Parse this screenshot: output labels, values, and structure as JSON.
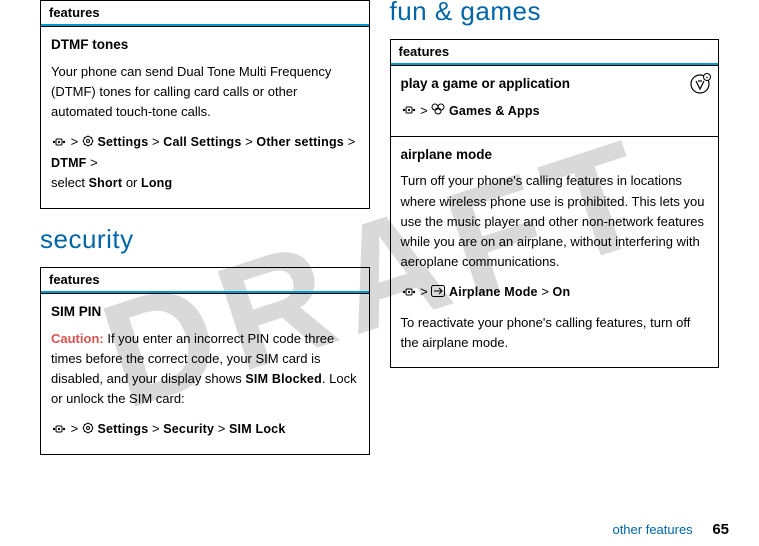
{
  "watermark": "DRAFT",
  "sections": {
    "security_heading": "security",
    "fun_heading": "fun & games"
  },
  "box1": {
    "header": "features",
    "title": "DTMF tones",
    "body": "Your phone can send Dual Tone Multi Frequency (DTMF) tones for calling card calls or other automated touch-tone calls.",
    "path_settings": "Settings",
    "path_call": "Call Settings",
    "path_other": "Other settings",
    "path_dtmf": "DTMF",
    "suffix_prefix": "select ",
    "opt_short": "Short",
    "or": " or ",
    "opt_long": "Long"
  },
  "box2": {
    "header": "features",
    "title": "SIM PIN",
    "caution_label": "Caution:",
    "caution_text": " If you enter an incorrect PIN code three times before the correct code, your SIM card is disabled, and your display shows ",
    "blocked": "SIM Blocked",
    "caution_tail": ". Lock or unlock the SIM card:",
    "path_settings": "Settings",
    "path_security": " Security",
    "path_simlock": "SIM Lock"
  },
  "box3": {
    "header": "features",
    "cell1": {
      "title": "play a game or application",
      "path_games": "Games & Apps"
    },
    "cell2": {
      "title": "airplane mode",
      "body": "Turn off your phone's calling features in locations where wireless phone use is prohibited. This lets you use the music player and other non-network features while you are on an airplane, without interfering with aeroplane communications.",
      "path_airplane": "Airplane Mode",
      "path_on": "On",
      "tail": "To reactivate your phone's calling features, turn off the airplane mode."
    }
  },
  "footer": {
    "text": "other features",
    "page": "65"
  },
  "glyphs": {
    "gt": ">"
  }
}
